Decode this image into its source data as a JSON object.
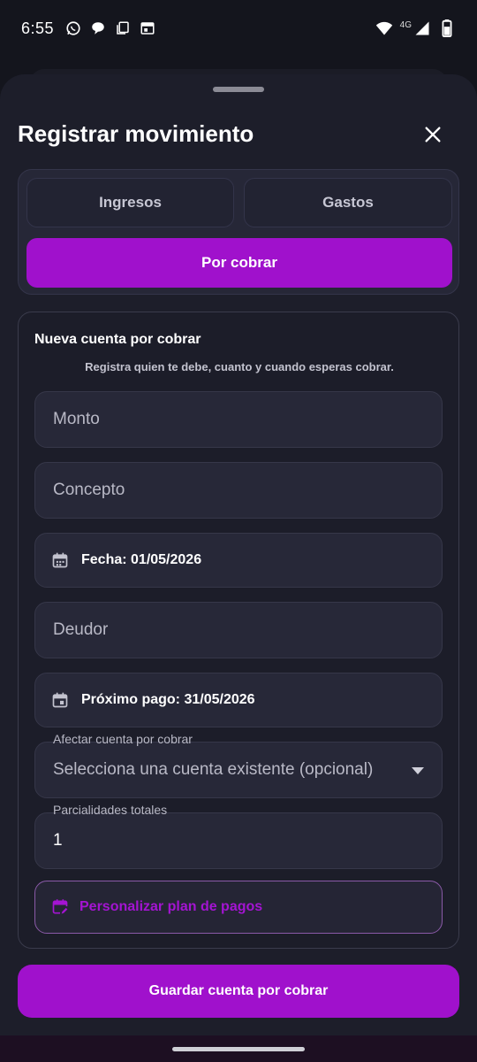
{
  "status_bar": {
    "time": "6:55",
    "network": "4G",
    "left_icons": [
      "whatsapp-icon",
      "chat-bubble-icon",
      "copy-icon",
      "calendar-widget-icon"
    ],
    "right_icons": [
      "wifi-icon",
      "signal-icon",
      "battery-icon"
    ]
  },
  "sheet": {
    "title": "Registrar movimiento",
    "close_icon": "close-icon"
  },
  "type_selector": {
    "options": [
      {
        "label": "Ingresos",
        "selected": false
      },
      {
        "label": "Gastos",
        "selected": false
      },
      {
        "label": "Por cobrar",
        "selected": true
      }
    ]
  },
  "form": {
    "heading": "Nueva cuenta por cobrar",
    "subtitle": "Registra quien te debe, cuanto y cuando esperas cobrar.",
    "amount_placeholder": "Monto",
    "concept_placeholder": "Concepto",
    "date_label": "Fecha: 01/05/2026",
    "debtor_placeholder": "Deudor",
    "next_payment_label": "Próximo pago: 31/05/2026",
    "affect_account_label": "Afectar cuenta por cobrar",
    "affect_account_value": "Selecciona una cuenta existente (opcional)",
    "installments_label": "Parcialidades totales",
    "installments_value": "1",
    "plan_button": "Personalizar plan de pagos"
  },
  "save_button": "Guardar cuenta por cobrar",
  "colors": {
    "accent": "#a011cc",
    "background": "#14151d",
    "sheet": "#1d1e2a",
    "field": "#272838"
  }
}
